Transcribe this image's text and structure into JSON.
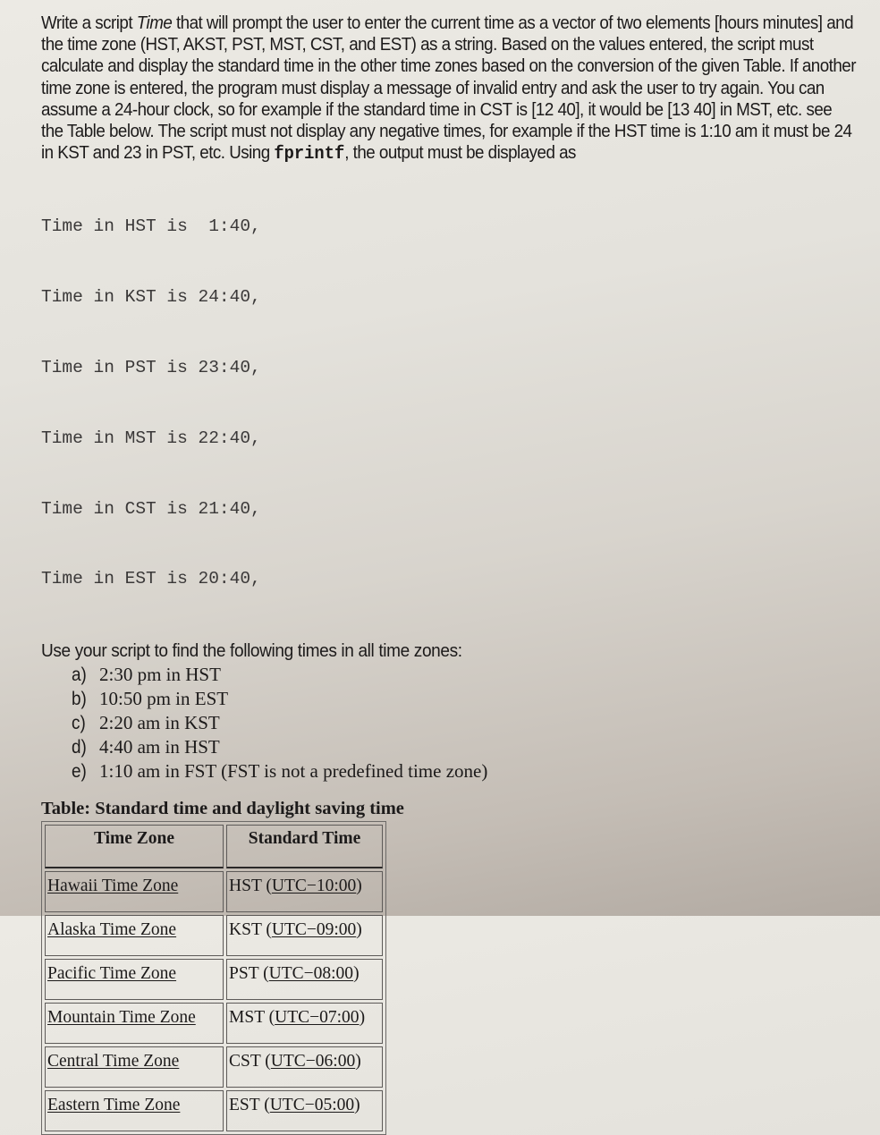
{
  "problem": {
    "intro_1": "Write a script ",
    "script_name": "Time",
    "intro_2": " that will prompt the user to enter the current time as a vector of two elements [hours minutes] and the time zone (HST, AKST, PST, MST, CST, and EST) as a string.  Based on the values entered, the script must calculate and display the standard time in the other time zones based on the conversion of the given Table.  If another time zone is entered, the program must display a message of invalid entry and ask the user to try again. You can assume a 24-hour clock, so for example if the standard time in CST is [12 40], it would be [13 40] in MST, etc. see the Table below. The script must not display any negative times, for example if the HST time is 1:10 am it must be 24 in KST and 23 in PST, etc. Using ",
    "code_word": "fprintf",
    "intro_3": ", the output must be displayed as"
  },
  "sample_output": [
    "Time in HST is  1:40,",
    "Time in KST is 24:40,",
    "Time in PST is 23:40,",
    "Time in MST is 22:40,",
    "Time in CST is 21:40,",
    "Time in EST is 20:40,"
  ],
  "tasks_intro": "Use your script to find the following times in all time zones:",
  "tasks": [
    {
      "label": "a)",
      "text": "2:30 pm in HST"
    },
    {
      "label": "b)",
      "text": "10:50 pm in EST"
    },
    {
      "label": "c)",
      "text": "2:20 am in KST"
    },
    {
      "label": "d)",
      "text": "4:40 am in HST"
    },
    {
      "label": "e)",
      "text": "1:10 am in FST (FST is not a predefined time zone)"
    }
  ],
  "table": {
    "title": "Table: Standard time and daylight saving time",
    "headers": [
      "Time Zone",
      "Standard Time"
    ],
    "rows": [
      {
        "zone": "Hawaii Time Zone",
        "abbr": "HST (",
        "utc": "UTC−10:00",
        "close": ")"
      },
      {
        "zone": "Alaska Time Zone",
        "abbr": "KST (",
        "utc": "UTC−09:00",
        "close": ")"
      },
      {
        "zone": "Pacific Time Zone",
        "abbr": "PST (",
        "utc": "UTC−08:00",
        "close": ")"
      },
      {
        "zone": "Mountain Time Zone",
        "abbr": "MST (",
        "utc": "UTC−07:00",
        "close": ")"
      },
      {
        "zone": "Central Time Zone",
        "abbr": "CST (",
        "utc": "UTC−06:00",
        "close": ")"
      },
      {
        "zone": "Eastern Time Zone",
        "abbr": "EST (",
        "utc": "UTC−05:00",
        "close": ")"
      }
    ]
  }
}
